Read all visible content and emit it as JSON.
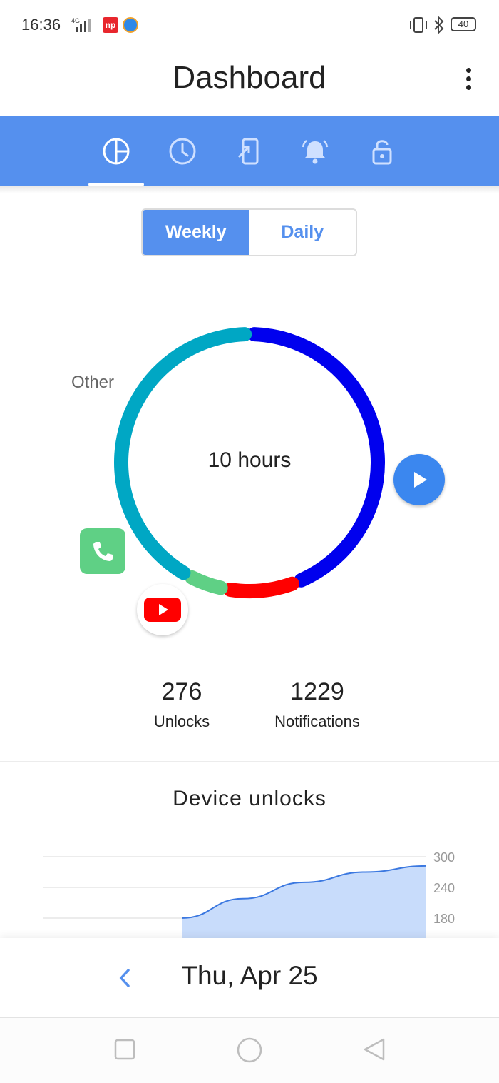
{
  "status_bar": {
    "time": "16:36",
    "network": "4G",
    "battery": "40",
    "icons": [
      "signal-icon",
      "np-app-icon",
      "circle-app-icon",
      "vibrate-icon",
      "bluetooth-icon",
      "battery-icon"
    ]
  },
  "app_bar": {
    "title": "Dashboard",
    "menu_icon": "more-vert-icon"
  },
  "tabs": [
    {
      "icon": "pie-chart-icon",
      "selected": true
    },
    {
      "icon": "clock-icon",
      "selected": false
    },
    {
      "icon": "phone-pickup-icon",
      "selected": false
    },
    {
      "icon": "bell-icon",
      "selected": false
    },
    {
      "icon": "lock-icon",
      "selected": false
    }
  ],
  "segmented": {
    "weekly": "Weekly",
    "daily": "Daily",
    "selected": "Weekly"
  },
  "donut": {
    "center_label": "10 hours",
    "other_label": "Other",
    "segments": [
      {
        "app": "Main app",
        "color": "#0000ee",
        "fraction": 0.44
      },
      {
        "app": "YouTube",
        "color": "#ff0000",
        "fraction": 0.09
      },
      {
        "app": "Phone",
        "color": "#5fd085",
        "fraction": 0.05
      },
      {
        "app": "Other",
        "color": "#00a7c4",
        "fraction": 0.42
      }
    ],
    "play_icon": "play-icon",
    "phone_icon": "phone-icon",
    "youtube_icon": "youtube-icon"
  },
  "stats": {
    "unlocks_value": "276",
    "unlocks_label": "Unlocks",
    "notifications_value": "1229",
    "notifications_label": "Notifications"
  },
  "unlocks_chart": {
    "title": "Device unlocks",
    "y_ticks": [
      "300",
      "240",
      "180"
    ]
  },
  "chart_data": {
    "type": "area",
    "title": "Device unlocks",
    "ylim": [
      180,
      300
    ],
    "y_ticks": [
      300,
      240,
      180
    ],
    "x": [
      0,
      1,
      2,
      3,
      4
    ],
    "values": [
      180,
      218,
      250,
      270,
      282
    ],
    "grid": true,
    "color": "#5590ee"
  },
  "date_nav": {
    "prev_icon": "chevron-left-icon",
    "date": "Thu, Apr 25"
  },
  "nav_bar": {
    "icons": [
      "recents-icon",
      "home-icon",
      "back-icon"
    ]
  },
  "colors": {
    "accent": "#5590ee",
    "tab_bar": "#5590ee",
    "play": "#3b87ef"
  }
}
